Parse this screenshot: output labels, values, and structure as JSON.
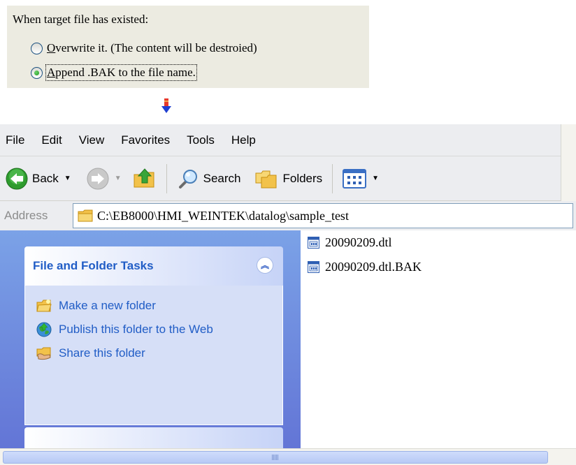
{
  "option_panel": {
    "title": "When target file has existed:",
    "options": [
      {
        "mnemonic": "O",
        "rest": "verwrite it. (The content will be destroied)",
        "checked": false
      },
      {
        "mnemonic": "A",
        "rest": "ppend .BAK to the file name.",
        "checked": true
      }
    ]
  },
  "arrow": {
    "icon": "down-arrow-icon",
    "colors": [
      "#e8392a",
      "#1f3fd1"
    ]
  },
  "explorer": {
    "menu": [
      "File",
      "Edit",
      "View",
      "Favorites",
      "Tools",
      "Help"
    ],
    "toolbar": {
      "back_label": "Back",
      "search_label": "Search",
      "folders_label": "Folders",
      "icons": [
        "back-icon",
        "forward-icon",
        "up-folder-icon",
        "search-icon",
        "folders-icon",
        "views-icon"
      ]
    },
    "address": {
      "label": "Address",
      "path": "C:\\EB8000\\HMI_WEINTEK\\datalog\\sample_test"
    },
    "task_pane": {
      "title": "File and Folder Tasks",
      "items": [
        {
          "label": "Make a new folder",
          "icon": "new-folder-icon"
        },
        {
          "label": "Publish this folder to the Web",
          "icon": "publish-web-icon"
        },
        {
          "label": "Share this folder",
          "icon": "share-folder-icon"
        }
      ]
    },
    "files": [
      {
        "name": "20090209.dtl",
        "icon": "dtl-file-icon"
      },
      {
        "name": "20090209.dtl.BAK",
        "icon": "dtl-file-icon"
      }
    ],
    "colors": {
      "task_pane_gradient_top": "#7ba2e7",
      "task_pane_gradient_bottom": "#6375d6",
      "task_link": "#215dc6",
      "panel_bg": "#ecebe1"
    }
  }
}
